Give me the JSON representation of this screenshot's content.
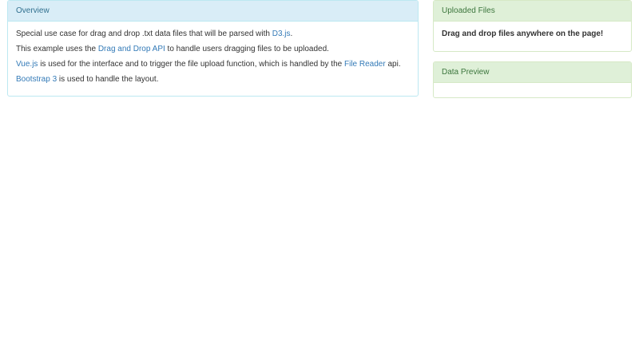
{
  "overview": {
    "heading": "Overview",
    "line1": {
      "text": "Special use case for drag and drop .txt data files that will be parsed with ",
      "link": "D3.js",
      "end": "."
    },
    "line2": {
      "before": "This example uses the ",
      "link": "Drag and Drop API",
      "after": " to handle users dragging files to be uploaded."
    },
    "line3": {
      "link1": "Vue.js",
      "middle": " is used for the interface and to trigger the file upload function, which is handled by the ",
      "link2": "File Reader",
      "end": " api."
    },
    "line4": {
      "link": "Bootstrap 3",
      "after": " is used to handle the layout."
    }
  },
  "uploaded": {
    "heading": "Uploaded Files",
    "drop_text": "Drag and drop files anywhere on the page!"
  },
  "preview": {
    "heading": "Data Preview"
  },
  "colors": {
    "info_heading_bg": "#d9edf7",
    "info_heading_text": "#31708f",
    "success_heading_bg": "#dff0d8",
    "success_heading_text": "#3c763d",
    "link": "#337ab7"
  }
}
